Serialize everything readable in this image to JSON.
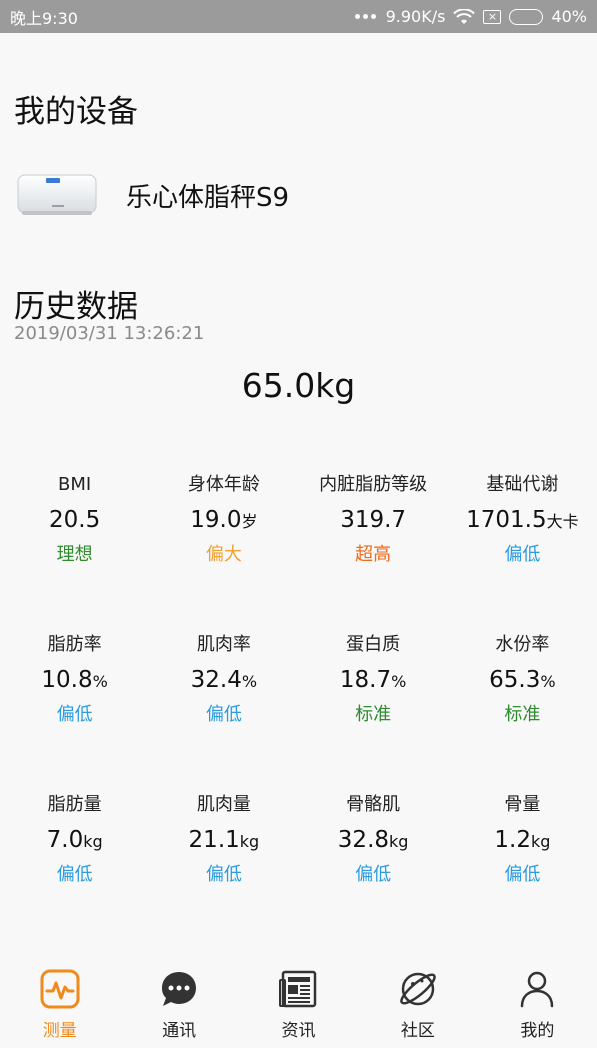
{
  "status_bar": {
    "time": "晚上9:30",
    "network_speed": "9.90K/s",
    "battery": "40%",
    "battery_level": 0.4
  },
  "devices": {
    "title": "我的设备",
    "items": [
      {
        "name": "乐心体脂秤S9",
        "icon": "scale-image"
      }
    ]
  },
  "history": {
    "title": "历史数据",
    "timestamp": "2019/03/31 13:26:21",
    "weight": "65.0kg"
  },
  "colors": {
    "green": "#2e8b2e",
    "orange_warn": "#f0a030",
    "orange_high": "#ee6a1a",
    "blue": "#2b9be0",
    "accent": "#f08a1c"
  },
  "metrics": [
    {
      "label": "BMI",
      "value": "20.5",
      "unit": "",
      "status": "理想",
      "status_color": "#2e8b2e"
    },
    {
      "label": "身体年龄",
      "value": "19.0",
      "unit": "岁",
      "status": "偏大",
      "status_color": "#f0a030"
    },
    {
      "label": "内脏脂肪等级",
      "value": "319.7",
      "unit": "",
      "status": "超高",
      "status_color": "#ee6a1a"
    },
    {
      "label": "基础代谢",
      "value": "1701.5",
      "unit": "大卡",
      "status": "偏低",
      "status_color": "#2b9be0"
    },
    {
      "label": "脂肪率",
      "value": "10.8",
      "unit": "%",
      "status": "偏低",
      "status_color": "#2b9be0"
    },
    {
      "label": "肌肉率",
      "value": "32.4",
      "unit": "%",
      "status": "偏低",
      "status_color": "#2b9be0"
    },
    {
      "label": "蛋白质",
      "value": "18.7",
      "unit": "%",
      "status": "标准",
      "status_color": "#2e8b2e"
    },
    {
      "label": "水份率",
      "value": "65.3",
      "unit": "%",
      "status": "标准",
      "status_color": "#2e8b2e"
    },
    {
      "label": "脂肪量",
      "value": "7.0",
      "unit": "kg",
      "status": "偏低",
      "status_color": "#2b9be0"
    },
    {
      "label": "肌肉量",
      "value": "21.1",
      "unit": "kg",
      "status": "偏低",
      "status_color": "#2b9be0"
    },
    {
      "label": "骨骼肌",
      "value": "32.8",
      "unit": "kg",
      "status": "偏低",
      "status_color": "#2b9be0"
    },
    {
      "label": "骨量",
      "value": "1.2",
      "unit": "kg",
      "status": "偏低",
      "status_color": "#2b9be0"
    }
  ],
  "tabs": [
    {
      "label": "测量",
      "icon": "measure-icon",
      "active": true
    },
    {
      "label": "通讯",
      "icon": "chat-icon",
      "active": false
    },
    {
      "label": "资讯",
      "icon": "news-icon",
      "active": false
    },
    {
      "label": "社区",
      "icon": "community-icon",
      "active": false
    },
    {
      "label": "我的",
      "icon": "profile-icon",
      "active": false
    }
  ]
}
